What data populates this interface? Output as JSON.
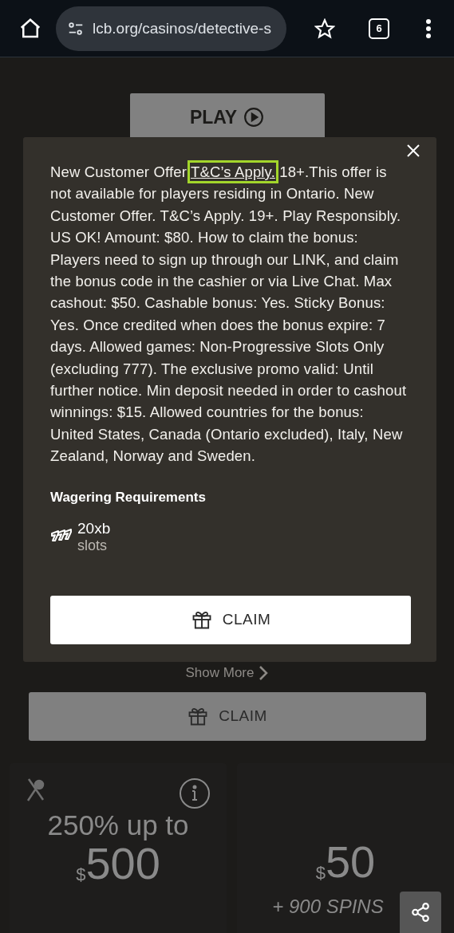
{
  "browser": {
    "url": "lcb.org/casinos/detective-s",
    "tab_count": "6"
  },
  "play_button": {
    "label": "PLAY"
  },
  "offer_modal": {
    "terms_before": "New Customer Offer",
    "terms_link": "T&C’s Apply.",
    "terms_after": "18+.This offer is not available for players residing in Ontario. New Customer Offer. T&C’s Apply. 19+. Play Responsibly. US OK! Amount: $80. How to claim the bonus: Players need to sign up through our LINK, and claim the bonus code in the cashier or via Live Chat. Max cashout: $50. Cashable bonus: Yes. Sticky Bonus: Yes. Once credited when does the bonus expire: 7 days. Allowed games: Non-Progressive Slots Only (excluding 777). The exclusive promo valid: Until further notice. Min deposit needed in order to cashout winnings: $15. Allowed countries for the bonus:  United States, Canada (Ontario excluded), Italy, New Zealand, Norway and Sweden.",
    "wagering_title": "Wagering Requirements",
    "wagering": {
      "amount": "20xb",
      "games": "slots"
    },
    "claim_label": "CLAIM"
  },
  "show_more": "Show More",
  "claim_button": {
    "label": "CLAIM"
  },
  "bonus_cards": [
    {
      "headline": "250% up to",
      "currency": "$",
      "amount": "500"
    },
    {
      "currency": "$",
      "amount": "50",
      "subline": "+ 900 SPINS"
    }
  ]
}
